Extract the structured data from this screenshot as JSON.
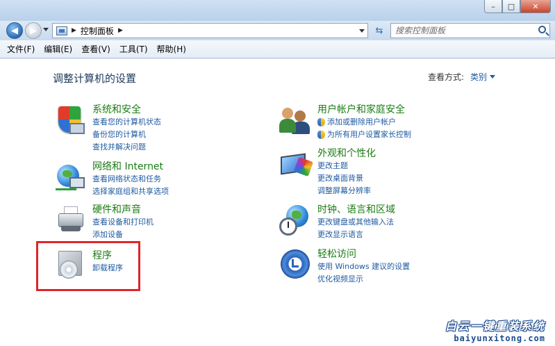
{
  "window": {
    "minimize_glyph": "–",
    "maximize_glyph": "□",
    "close_glyph": "✕"
  },
  "address": {
    "path": "控制面板",
    "separator": "▶",
    "search_placeholder": "搜索控制面板"
  },
  "menu": [
    "文件(F)",
    "编辑(E)",
    "查看(V)",
    "工具(T)",
    "帮助(H)"
  ],
  "page": {
    "title": "调整计算机的设置",
    "view_by_label": "查看方式:",
    "view_by_value": "类别"
  },
  "categories": {
    "security": {
      "title": "系统和安全",
      "icon": "shield-icon",
      "links": [
        "查看您的计算机状态",
        "备份您的计算机",
        "查找并解决问题"
      ]
    },
    "network": {
      "title": "网络和 Internet",
      "icon": "network-globe-icon",
      "links": [
        "查看网络状态和任务",
        "选择家庭组和共享选项"
      ]
    },
    "hardware": {
      "title": "硬件和声音",
      "icon": "printer-icon",
      "links": [
        "查看设备和打印机",
        "添加设备"
      ]
    },
    "programs": {
      "title": "程序",
      "icon": "programs-disk-icon",
      "links": [
        "卸载程序"
      ]
    },
    "users": {
      "title": "用户帐户和家庭安全",
      "icon": "users-icon",
      "links": [
        "添加或删除用户帐户",
        "为所有用户设置家长控制"
      ]
    },
    "appearance": {
      "title": "外观和个性化",
      "icon": "appearance-icon",
      "links": [
        "更改主题",
        "更改桌面背景",
        "调整屏幕分辨率"
      ]
    },
    "clock": {
      "title": "时钟、语言和区域",
      "icon": "clock-globe-icon",
      "links": [
        "更改键盘或其他输入法",
        "更改显示语言"
      ]
    },
    "access": {
      "title": "轻松访问",
      "icon": "ease-of-access-icon",
      "links": [
        "使用 Windows 建议的设置",
        "优化视频显示"
      ]
    }
  },
  "watermark": {
    "title": "白云一键重装系统",
    "url": "baiyunxitong.com"
  },
  "colors": {
    "category_title": "#1a7c13",
    "link": "#1e5aa0",
    "highlight": "#e0252a"
  }
}
